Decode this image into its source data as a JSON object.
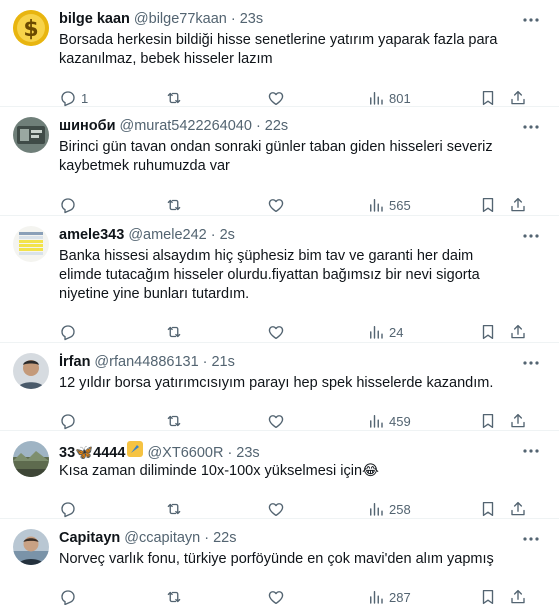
{
  "tweets": [
    {
      "name": "bilge kaan",
      "handle": "@bilge77kaan",
      "time": "23s",
      "text": "Borsada herkesin bildiği hisse senetlerine yatırım yaparak fazla para kazanılmaz, bebek hisseler lazım",
      "replies": "1",
      "views": "801",
      "avatar": "dollar-coin"
    },
    {
      "name": "шинoби",
      "handle": "@murat5422264040",
      "time": "22s",
      "text": "Birinci gün tavan ondan sonraki günler taban giden hisseleri severiz kaybetmek ruhumuzda var",
      "replies": "",
      "views": "565",
      "avatar": "photo"
    },
    {
      "name": "amele343",
      "handle": "@amele242",
      "time": "2s",
      "text": "Banka hissesi alsaydım hiç şüphesiz bim tav ve garanti her daim elimde tutacağım hisseler olurdu.fiyattan bağımsız bir nevi sigorta niyetine yine bunları tutardım.",
      "replies": "",
      "views": "24",
      "avatar": "table"
    },
    {
      "name": "İrfan",
      "handle": "@rfan44886131",
      "time": "21s",
      "text": "12 yıldır borsa yatırımcısıyım parayı hep spek hisselerde kazandım.",
      "replies": "",
      "views": "459",
      "avatar": "person"
    },
    {
      "name": "33🦋4444",
      "handle": "@XT6600R",
      "time": "23s",
      "text": "Kısa zaman diliminde 10x-100x yükselmesi için😂",
      "replies": "",
      "views": "258",
      "avatar": "landscape"
    },
    {
      "name": "Capitayn",
      "handle": "@ccapitayn",
      "time": "22s",
      "text": "Norveç varlık fonu, türkiye porföyünde en çok mavi'den alım yapmış",
      "replies": "",
      "views": "287",
      "avatar": "person"
    }
  ],
  "colors": {
    "text": "#0f1419",
    "secondary": "#536471",
    "border": "#eff3f4"
  },
  "icons": [
    "reply-icon",
    "retweet-icon",
    "like-icon",
    "views-icon",
    "bookmark-icon",
    "share-icon",
    "more-icon"
  ]
}
